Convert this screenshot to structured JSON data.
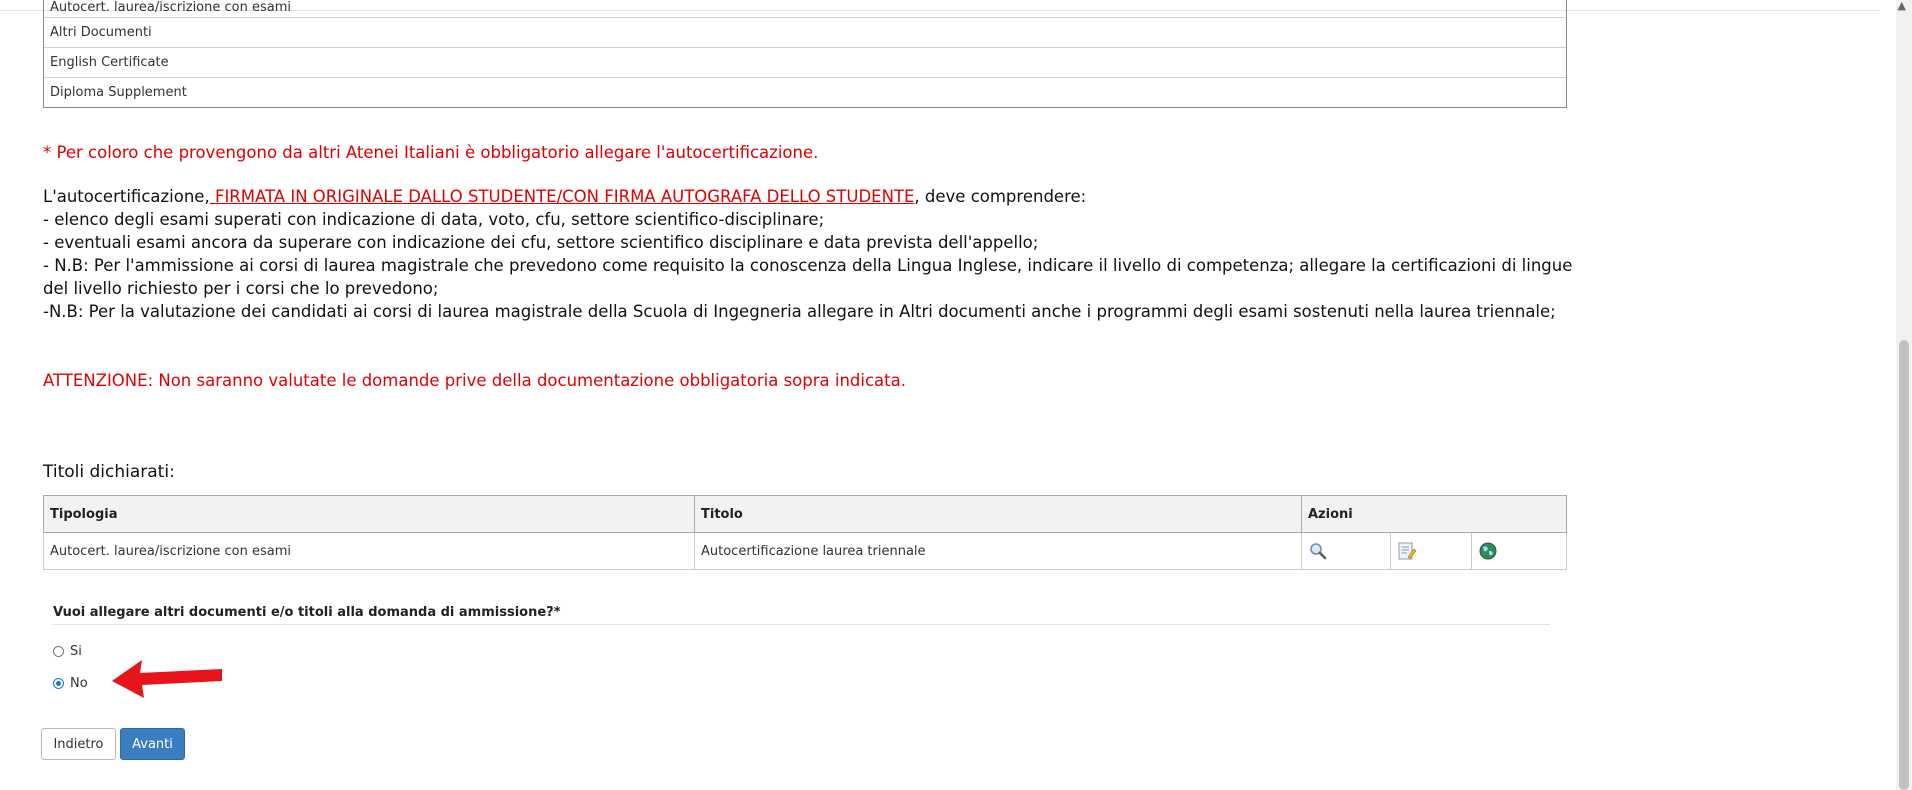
{
  "documents": [
    "Autocert. laurea/iscrizione con esami",
    "Altri Documenti",
    "English Certificate",
    "Diploma Supplement"
  ],
  "notice_mandatory": "* Per coloro che provengono da altri Atenei Italiani è obbligatorio allegare l'autocertificazione.",
  "body": {
    "intro_prefix": "L'autocertificazione,",
    "intro_signed": " FIRMATA IN ORIGINALE DALLO STUDENTE/CON FIRMA AUTOGRAFA DELLO STUDENTE",
    "intro_suffix": ", deve comprendere:",
    "line1": "- elenco degli esami superati con indicazione di data, voto, cfu, settore scientifico-disciplinare;",
    "line2": "- eventuali esami ancora da superare con indicazione dei cfu, settore scientifico disciplinare e data prevista dell'appello;",
    "line3": "- N.B: Per l'ammissione ai corsi di laurea magistrale che prevedono come requisito la conoscenza della Lingua Inglese, indicare il livello di competenza; allegare la certificazioni di lingue del livello richiesto per i corsi che lo prevedono;",
    "line4": "-N.B: Per la valutazione dei candidati ai corsi di laurea magistrale della Scuola di Ingegneria allegare in Altri documenti anche i programmi degli esami sostenuti nella laurea triennale;"
  },
  "warning": "ATTENZIONE: Non saranno valutate le domande prive della documentazione obbligatoria sopra indicata.",
  "titles_section": "Titoli dichiarati:",
  "titles_table": {
    "headers": {
      "tipologia": "Tipologia",
      "titolo": "Titolo",
      "azioni": "Azioni"
    },
    "rows": [
      {
        "tipologia": "Autocert. laurea/iscrizione con esami",
        "titolo": "Autocertificazione laurea triennale",
        "actions": [
          "magnifier-icon",
          "edit-icon",
          "globe-icon"
        ]
      }
    ]
  },
  "question": "Vuoi allegare altri documenti e/o titoli alla domanda di ammissione?*",
  "radio": {
    "yes": "Si",
    "no": "No",
    "selected": "No"
  },
  "buttons": {
    "back": "Indietro",
    "next": "Avanti"
  },
  "colors": {
    "notice_red": "#e00000",
    "primary_button": "#3a7dc0",
    "arrow": "#e8141b"
  }
}
